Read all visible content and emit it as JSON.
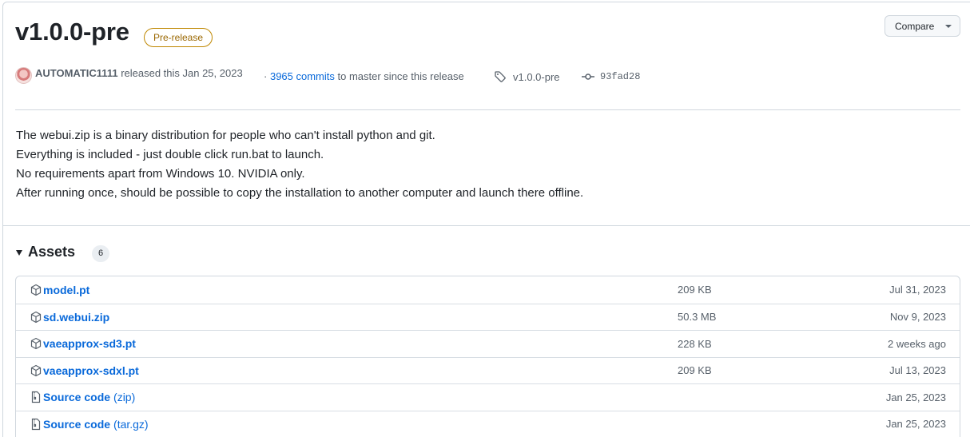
{
  "release": {
    "title": "v1.0.0-pre",
    "badge": "Pre-release",
    "compare_label": "Compare",
    "author": "AUTOMATIC1111",
    "released_text": "released this Jan 25, 2023",
    "commits_link": "3965 commits",
    "commits_suffix": "to master since this release",
    "tag": "v1.0.0-pre",
    "commit": "93fad28"
  },
  "description": [
    "The webui.zip is a binary distribution for people who can't install python and git.",
    "Everything is included - just double click run.bat to launch.",
    "No requirements apart from Windows 10. NVIDIA only.",
    "After running once, should be possible to copy the installation to another computer and launch there offline."
  ],
  "assets": {
    "heading": "Assets",
    "count": "6",
    "items": [
      {
        "name": "model.pt",
        "ext": "",
        "size": "209 KB",
        "date": "Jul 31, 2023",
        "icon": "package-icon"
      },
      {
        "name": "sd.webui.zip",
        "ext": "",
        "size": "50.3 MB",
        "date": "Nov 9, 2023",
        "icon": "package-icon"
      },
      {
        "name": "vaeapprox-sd3.pt",
        "ext": "",
        "size": "228 KB",
        "date": "2 weeks ago",
        "icon": "package-icon"
      },
      {
        "name": "vaeapprox-sdxl.pt",
        "ext": "",
        "size": "209 KB",
        "date": "Jul 13, 2023",
        "icon": "package-icon"
      },
      {
        "name": "Source code",
        "ext": "(zip)",
        "size": "",
        "date": "Jan 25, 2023",
        "icon": "file-zip-icon"
      },
      {
        "name": "Source code",
        "ext": "(tar.gz)",
        "size": "",
        "date": "Jan 25, 2023",
        "icon": "file-zip-icon"
      }
    ]
  },
  "colors": {
    "link": "#0969da",
    "badge_border": "#bf8700",
    "badge_text": "#9a6700",
    "muted": "#57606a"
  }
}
